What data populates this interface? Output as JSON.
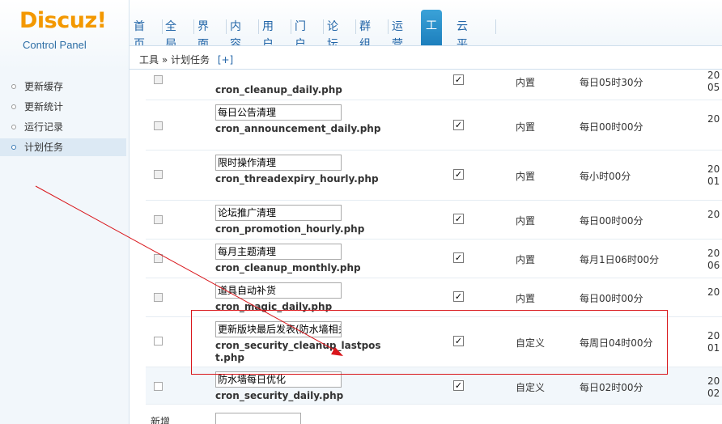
{
  "logo": {
    "name": "Discuz!",
    "subtitle": "Control Panel"
  },
  "nav": {
    "items": [
      {
        "label": "首页"
      },
      {
        "label": "全局"
      },
      {
        "label": "界面"
      },
      {
        "label": "内容"
      },
      {
        "label": "用户"
      },
      {
        "label": "门户"
      },
      {
        "label": "论坛"
      },
      {
        "label": "群组"
      },
      {
        "label": "运营"
      },
      {
        "label": "工具",
        "active": true
      },
      {
        "label": "云平台"
      }
    ]
  },
  "breadcrumb": {
    "text": "工具 » 计划任务",
    "add": "[+]"
  },
  "sidebar": {
    "items": [
      {
        "label": "更新缓存"
      },
      {
        "label": "更新统计"
      },
      {
        "label": "运行记录"
      },
      {
        "label": "计划任务",
        "active": true
      }
    ]
  },
  "rows": [
    {
      "name": "",
      "file": "cron_cleanup_daily.php",
      "type": "内置",
      "time": "每日05时30分",
      "date": "20 05",
      "checked": true
    },
    {
      "name": "每日公告清理",
      "file": "cron_announcement_daily.php",
      "type": "内置",
      "time": "每日00时00分",
      "date": "20 ",
      "checked": true
    },
    {
      "name": "限时操作清理",
      "file": "cron_threadexpiry_hourly.php",
      "type": "内置",
      "time": "每小时00分",
      "date": "20 01",
      "checked": true
    },
    {
      "name": "论坛推广清理",
      "file": "cron_promotion_hourly.php",
      "type": "内置",
      "time": "每日00时00分",
      "date": "20 ",
      "checked": true
    },
    {
      "name": "每月主题清理",
      "file": "cron_cleanup_monthly.php",
      "type": "内置",
      "time": "每月1日06时00分",
      "date": "20 06",
      "checked": true
    },
    {
      "name": "道具自动补货",
      "file": "cron_magic_daily.php",
      "type": "内置",
      "time": "每日00时00分",
      "date": "20 ",
      "checked": true
    },
    {
      "name": "更新版块最后发表(防水墙相关)",
      "file": "cron_security_cleanup_lastpost.php",
      "type": "自定义",
      "time": "每周日04时00分",
      "date": "20 01",
      "checked": true
    },
    {
      "name": "防水墙每日优化",
      "file": "cron_security_daily.php",
      "type": "自定义",
      "time": "每日02时00分",
      "date": "20 02",
      "checked": true
    }
  ],
  "new_row": {
    "label": "新增"
  },
  "icons": {
    "checkmark": "check-icon",
    "bullet": "bullet-icon"
  },
  "colors": {
    "accent": "#1d7fbd",
    "logo": "#f39800",
    "annotation": "#d9161b"
  }
}
